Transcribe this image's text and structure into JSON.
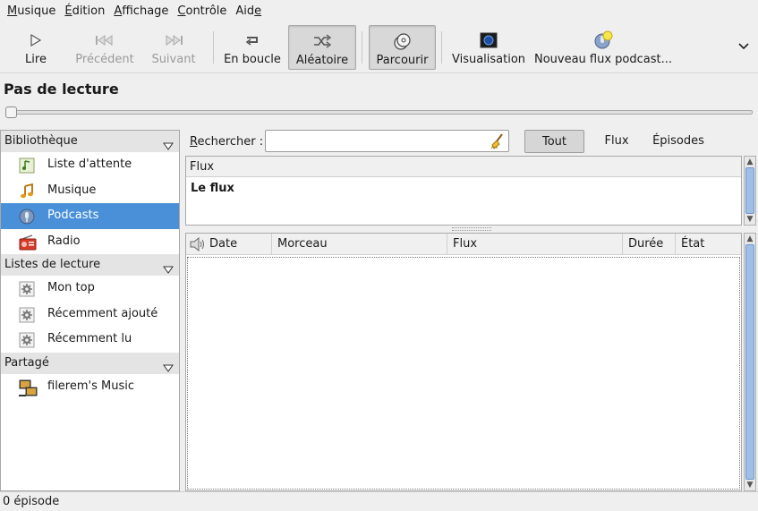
{
  "menu": {
    "items": [
      {
        "first": "M",
        "rest": "usique"
      },
      {
        "first": "É",
        "rest": "dition"
      },
      {
        "first": "A",
        "rest": "ffichage"
      },
      {
        "first": "C",
        "rest": "ontrôle"
      },
      {
        "first": "Aid",
        "rest": "e"
      }
    ]
  },
  "toolbar": {
    "play": "Lire",
    "previous": "Précédent",
    "next": "Suivant",
    "repeat": "En boucle",
    "shuffle": "Aléatoire",
    "browse": "Parcourir",
    "visualization": "Visualisation",
    "new_podcast": "Nouveau flux podcast..."
  },
  "now_playing": {
    "title": "Pas de lecture"
  },
  "sidebar": {
    "library_header": "Bibliothèque",
    "library_items": [
      "Liste d'attente",
      "Musique",
      "Podcasts",
      "Radio"
    ],
    "playlists_header": "Listes de lecture",
    "playlist_items": [
      "Mon top",
      "Récemment ajouté",
      "Récemment lu"
    ],
    "shared_header": "Partagé",
    "shared_items": [
      "filerem's Music"
    ]
  },
  "search": {
    "label_u": "R",
    "label_rest": "echercher :",
    "value": "",
    "filters": {
      "all": "Tout",
      "feeds": "Flux",
      "episodes": "Épisodes"
    }
  },
  "feeds": {
    "column": "Flux",
    "rows": [
      "Le flux"
    ]
  },
  "episodes": {
    "columns": [
      "Date",
      "Morceau",
      "Flux",
      "Durée",
      "État"
    ]
  },
  "status": {
    "text": "0 épisode"
  },
  "colors": {
    "selection": "#4a90d9",
    "scroll_thumb": "#9fbfe6"
  }
}
